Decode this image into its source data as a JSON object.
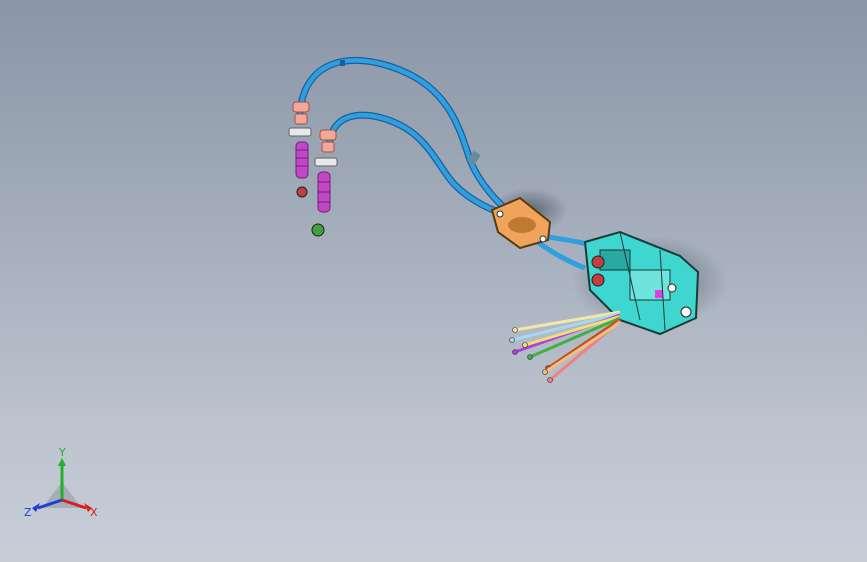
{
  "view": {
    "background_top": "#8a95a6",
    "background_bottom": "#c8ced8"
  },
  "model": {
    "cable_color": "#2f9fe0",
    "cable_outline": "#1b5f9a",
    "housing_color": "#3fd6cf",
    "bracket_color": "#f0a35a",
    "boot_color": "#c047c8",
    "bushing_color": "#f0a89a",
    "wire_colors": [
      "#f5e7a5",
      "#a8d8f0",
      "#b040e0",
      "#f0e070",
      "#40b040",
      "#c05020",
      "#f08080",
      "#f0c080"
    ]
  },
  "triad": {
    "y_label": "Y",
    "x_label": "X",
    "z_label": "Z",
    "y_color": "#21b02a",
    "x_color": "#d62020",
    "z_color": "#2040d0"
  }
}
